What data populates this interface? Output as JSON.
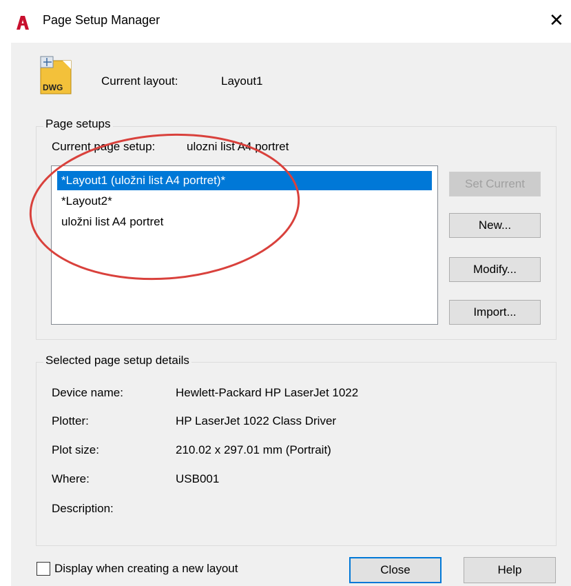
{
  "window": {
    "title": "Page Setup Manager",
    "close_glyph": "✕",
    "icon": "autocad-a-icon"
  },
  "header": {
    "file_icon": "dwg-file-icon",
    "file_icon_text": "DWG",
    "current_layout_label": "Current layout:",
    "current_layout_value": "Layout1"
  },
  "page_setups": {
    "group_label": "Page setups",
    "current_page_setup_label": "Current page setup:",
    "current_page_setup_value": "ulozni list A4 portret",
    "items": [
      {
        "label": "*Layout1 (uložni list A4 portret)*",
        "selected": true
      },
      {
        "label": "*Layout2*",
        "selected": false
      },
      {
        "label": "uložni list A4 portret",
        "selected": false
      }
    ],
    "buttons": {
      "set_current": "Set Current",
      "new": "New...",
      "modify": "Modify...",
      "import": "Import..."
    }
  },
  "details": {
    "group_label": "Selected page setup details",
    "device_name_label": "Device name:",
    "device_name_value": "Hewlett-Packard HP LaserJet 1022",
    "plotter_label": "Plotter:",
    "plotter_value": "HP LaserJet 1022 Class Driver",
    "plot_size_label": "Plot size:",
    "plot_size_value": "210.02 x 297.01 mm (Portrait)",
    "where_label": "Where:",
    "where_value": "USB001",
    "description_label": "Description:",
    "description_value": ""
  },
  "footer": {
    "display_checkbox_label": "Display when creating a new layout",
    "display_checkbox_checked": false,
    "close": "Close",
    "help": "Help"
  },
  "colors": {
    "selection": "#0078d7",
    "annotation_circle": "#d9413c",
    "app_icon": "#c8102e",
    "dialog_bg": "#f0f0f0"
  }
}
